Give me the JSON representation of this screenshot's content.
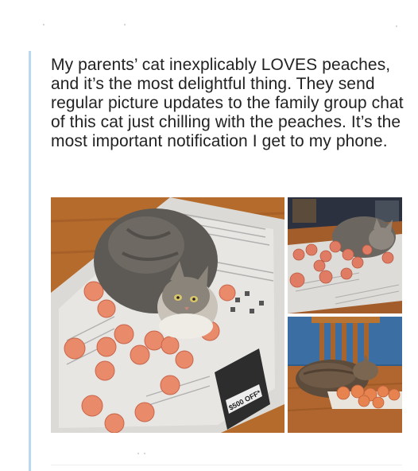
{
  "tweet": {
    "text": "My parents’ cat inexplicably LOVES peaches, and it’s the most delightful thing. They send regular picture updates to the family group chat of this cat just chilling with the peaches. It’s the most important notification I get to my phone."
  },
  "photos": [
    {
      "name": "cat-on-newspaper-with-peaches"
    },
    {
      "name": "cat-among-peaches-on-table"
    },
    {
      "name": "cat-sleeping-by-peaches"
    }
  ],
  "newspaper_print": {
    "deal_tag": "$500 OFF*"
  },
  "colors": {
    "quote_bar": "#b7d8ee",
    "text": "#222222",
    "peach": "#e98a6a",
    "table_wood": "#b0662e"
  }
}
